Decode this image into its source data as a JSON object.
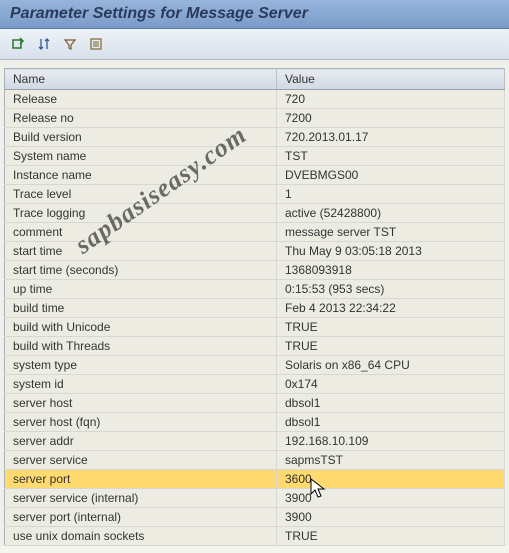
{
  "title": "Parameter Settings for Message Server",
  "toolbar": {
    "icons": [
      "refresh-icon",
      "sort-icon",
      "filter-icon",
      "settings-icon"
    ]
  },
  "table": {
    "headers": {
      "name": "Name",
      "value": "Value"
    },
    "rows": [
      {
        "name": "Release",
        "value": "720",
        "highlight": false
      },
      {
        "name": "Release no",
        "value": "7200",
        "highlight": false
      },
      {
        "name": "Build version",
        "value": "720.2013.01.17",
        "highlight": false
      },
      {
        "name": "System name",
        "value": "TST",
        "highlight": false
      },
      {
        "name": "Instance name",
        "value": "DVEBMGS00",
        "highlight": false
      },
      {
        "name": "Trace level",
        "value": "1",
        "highlight": false
      },
      {
        "name": "Trace logging",
        "value": "active (52428800)",
        "highlight": false
      },
      {
        "name": "comment",
        "value": "message server TST",
        "highlight": false
      },
      {
        "name": "start time",
        "value": "Thu May  9 03:05:18 2013",
        "highlight": false
      },
      {
        "name": "start time (seconds)",
        "value": "1368093918",
        "highlight": false
      },
      {
        "name": "up time",
        "value": "0:15:53 (953 secs)",
        "highlight": false
      },
      {
        "name": "build time",
        "value": "Feb  4 2013 22:34:22",
        "highlight": false
      },
      {
        "name": "build with Unicode",
        "value": "TRUE",
        "highlight": false
      },
      {
        "name": "build with Threads",
        "value": "TRUE",
        "highlight": false
      },
      {
        "name": "system type",
        "value": "Solaris on x86_64 CPU",
        "highlight": false
      },
      {
        "name": "system id",
        "value": "0x174",
        "highlight": false
      },
      {
        "name": "server host",
        "value": "dbsol1",
        "highlight": false
      },
      {
        "name": "server host (fqn)",
        "value": "dbsol1",
        "highlight": false
      },
      {
        "name": "server addr",
        "value": "192.168.10.109",
        "highlight": false
      },
      {
        "name": "server service",
        "value": "sapmsTST",
        "highlight": false
      },
      {
        "name": "server port",
        "value": "3600",
        "highlight": true
      },
      {
        "name": "server service (internal)",
        "value": "3900",
        "highlight": false
      },
      {
        "name": "server port (internal)",
        "value": "3900",
        "highlight": false
      },
      {
        "name": "use unix domain sockets",
        "value": "TRUE",
        "highlight": false
      }
    ]
  },
  "watermark": "sapbasiseasy.com"
}
